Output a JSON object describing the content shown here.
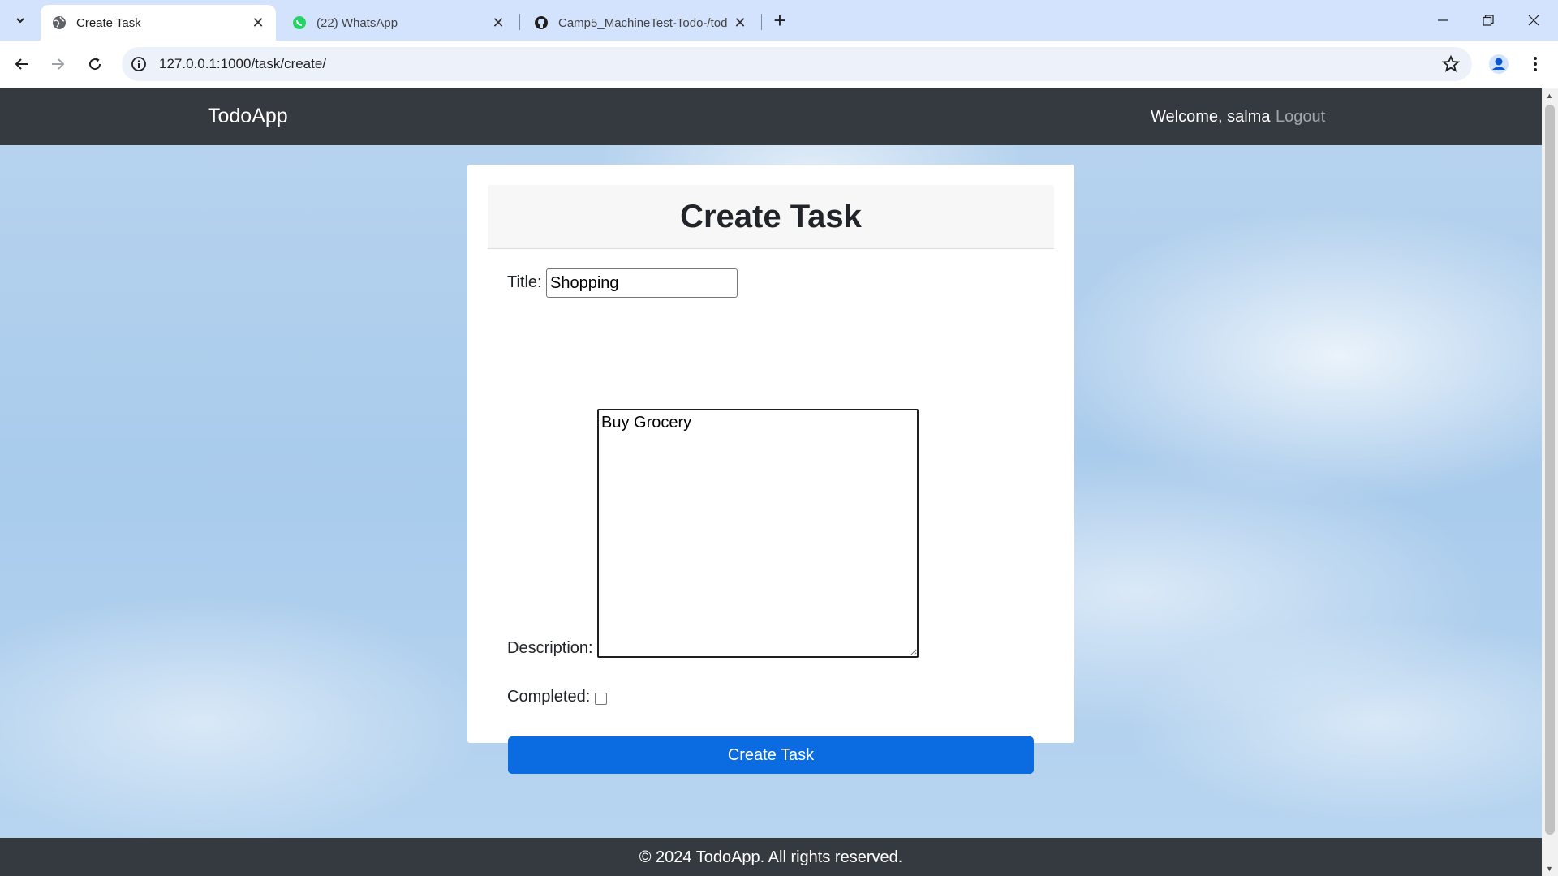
{
  "browser": {
    "tabs": [
      {
        "label": "Create Task",
        "favicon": "globe-icon",
        "active": true
      },
      {
        "label": "(22) WhatsApp",
        "favicon": "whatsapp-icon",
        "active": false
      },
      {
        "label": "Camp5_MachineTest-Todo-/tod",
        "favicon": "github-icon",
        "active": false
      }
    ],
    "url": "127.0.0.1:1000/task/create/"
  },
  "navbar": {
    "brand": "TodoApp",
    "welcome": "Welcome, salma",
    "logout": "Logout"
  },
  "form": {
    "heading": "Create Task",
    "title_label": "Title:",
    "title_value": "Shopping",
    "description_label": "Description:",
    "description_value": "Buy Grocery",
    "completed_label": "Completed:",
    "completed_checked": false,
    "submit_label": "Create Task"
  },
  "footer": {
    "text": "© 2024 TodoApp. All rights reserved."
  },
  "colors": {
    "navbar_bg": "#343a40",
    "primary_button": "#0a6ce0",
    "tabstrip_bg": "#d3e3fd"
  }
}
